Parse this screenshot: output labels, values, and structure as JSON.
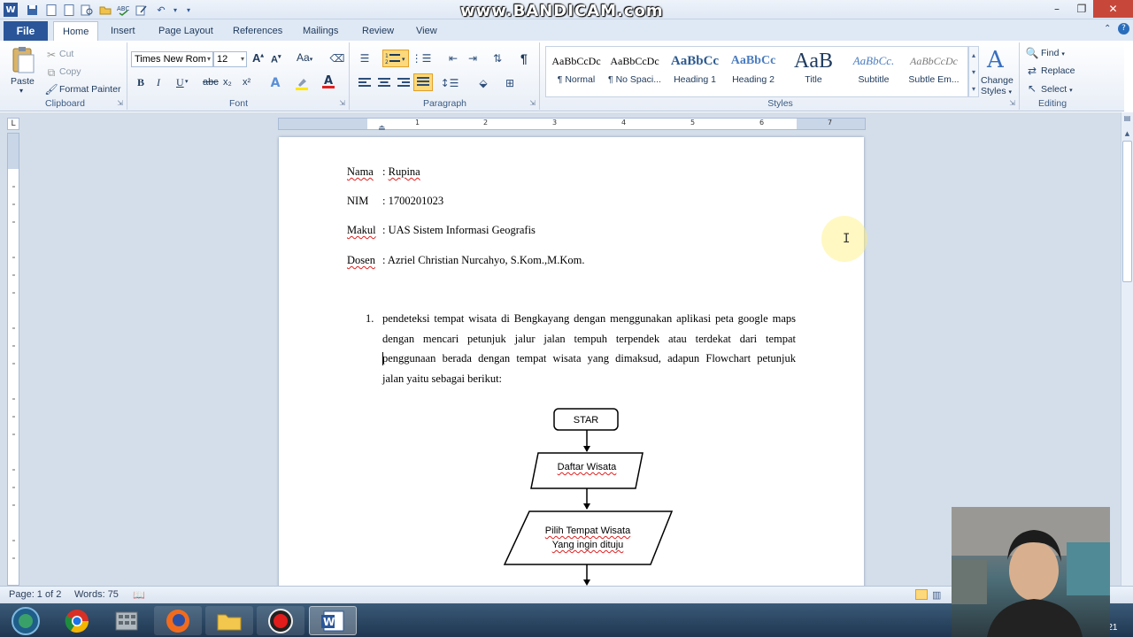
{
  "watermark": "www.BANDICAM.com",
  "tabs": {
    "file": "File",
    "items": [
      "Home",
      "Insert",
      "Page Layout",
      "References",
      "Mailings",
      "Review",
      "View"
    ]
  },
  "clipboard": {
    "paste": "Paste",
    "cut": "Cut",
    "copy": "Copy",
    "format_painter": "Format Painter",
    "label": "Clipboard"
  },
  "font": {
    "family": "Times New Rom",
    "size": "12",
    "label": "Font",
    "b": "B",
    "i": "I",
    "u": "U",
    "strike": "abc",
    "sub": "x₂",
    "sup": "x²",
    "grow": "A",
    "shrink": "A",
    "case": "Aa"
  },
  "paragraph": {
    "label": "Paragraph",
    "pilcrow": "¶"
  },
  "styles": {
    "label": "Styles",
    "items": [
      {
        "preview": "AaBbCcDc",
        "name": "¶ Normal"
      },
      {
        "preview": "AaBbCcDc",
        "name": "¶ No Spaci..."
      },
      {
        "preview": "AaBbCc",
        "name": "Heading 1"
      },
      {
        "preview": "AaBbCc",
        "name": "Heading 2"
      },
      {
        "preview": "AaB",
        "name": "Title"
      },
      {
        "preview": "AaBbCc.",
        "name": "Subtitle"
      },
      {
        "preview": "AaBbCcDc",
        "name": "Subtle Em..."
      }
    ],
    "change_styles_1": "Change",
    "change_styles_2": "Styles"
  },
  "editing": {
    "find": "Find",
    "replace": "Replace",
    "select": "Select",
    "label": "Editing"
  },
  "ruler": {
    "numbers": [
      "1",
      "2",
      "3",
      "4",
      "5",
      "6",
      "7"
    ]
  },
  "document": {
    "fields": [
      {
        "label": "Nama",
        "value": "Rupina"
      },
      {
        "label": "NIM",
        "value": "1700201023"
      },
      {
        "label": "Makul",
        "value": "UAS Sistem Informasi Geografis"
      },
      {
        "label": "Dosen",
        "value": "Azriel Christian Nurcahyo, S.Kom.,M.Kom."
      }
    ],
    "separator": ":",
    "list_number": "1.",
    "paragraph_lines": [
      "pendeteksi tempat wisata di Bengkayang dengan menggunakan aplikasi peta google maps",
      "dengan mencari petunjuk jalur jalan tempuh terpendek atau terdekat dari tempat",
      "penggunaan berada dengan tempat wisata yang dimaksud, adapun Flowchart petunjuk",
      "jalan yaitu sebagai berikut:"
    ],
    "flowchart": {
      "start": "STAR",
      "step1": "Daftar Wisata",
      "step2_line1": "Pilih Tempat Wisata",
      "step2_line2": "Yang ingin dituju"
    }
  },
  "status": {
    "page": "Page: 1 of 2",
    "words": "Words: 75"
  },
  "clock": {
    "date": "1/16/2021"
  }
}
